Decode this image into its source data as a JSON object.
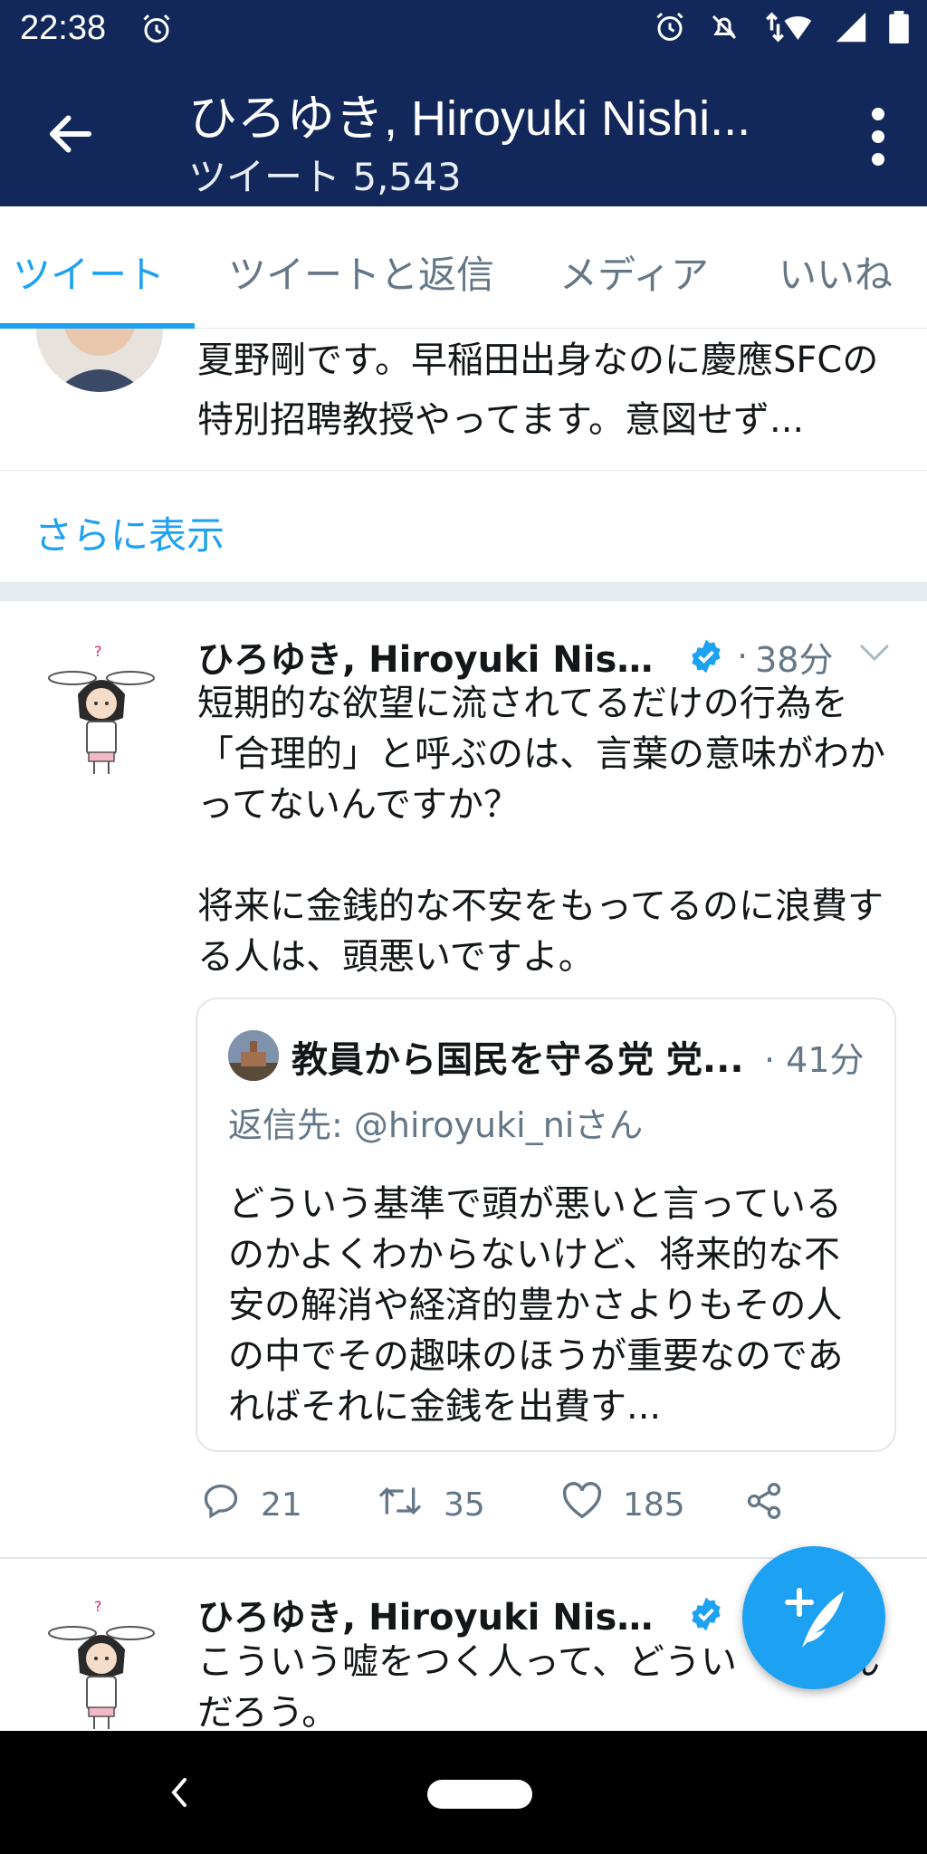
{
  "status_bar": {
    "time": "22:38",
    "icons": [
      "alarm-icon",
      "alarm-icon",
      "bell-off-icon",
      "wifi-icon",
      "signal-icon",
      "battery-icon"
    ]
  },
  "header": {
    "title": "ひろゆき, Hiroyuki Nishi...",
    "subtitle": "ツイート 5,543",
    "bg_color": "#12285a"
  },
  "tabs": [
    {
      "label": "ツイート",
      "active": true
    },
    {
      "label": "ツイートと返信",
      "active": false
    },
    {
      "label": "メディア",
      "active": false
    },
    {
      "label": "いいね",
      "active": false
    }
  ],
  "partial_tweet": {
    "text": "夏野剛です。早稲田出身なのに慶應SFCの特別招聘教授やってます。意図せず..."
  },
  "show_more": "さらに表示",
  "tweet1": {
    "name": "ひろゆき, Hiroyuki Nishim...",
    "time": "38分",
    "body": "短期的な欲望に流されてるだけの行為を「合理的」と呼ぶのは、言葉の意味がわかってないんですか？\n\n将来に金銭的な不安をもってるのに浪費する人は、頭悪いですよ。",
    "quote": {
      "name": "教員から国民を守る党 党...",
      "time": "41分",
      "reply_to": "返信先: @hiroyuki_niさん",
      "text": "どういう基準で頭が悪いと言っているのかよくわからないけど、将来的な不安の解消や経済的豊かさよりもその人の中でその趣味のほうが重要なのであればそれに金銭を出費す..."
    },
    "replies": "21",
    "retweets": "35",
    "likes": "185"
  },
  "tweet2": {
    "name": "ひろゆき, Hiroyuki Nishim...",
    "body": "こういう嘘をつく人って、どうい   機なんだろう。"
  },
  "colors": {
    "accent": "#1da1f2",
    "verified": "#1da1f2",
    "muted": "#657786"
  }
}
